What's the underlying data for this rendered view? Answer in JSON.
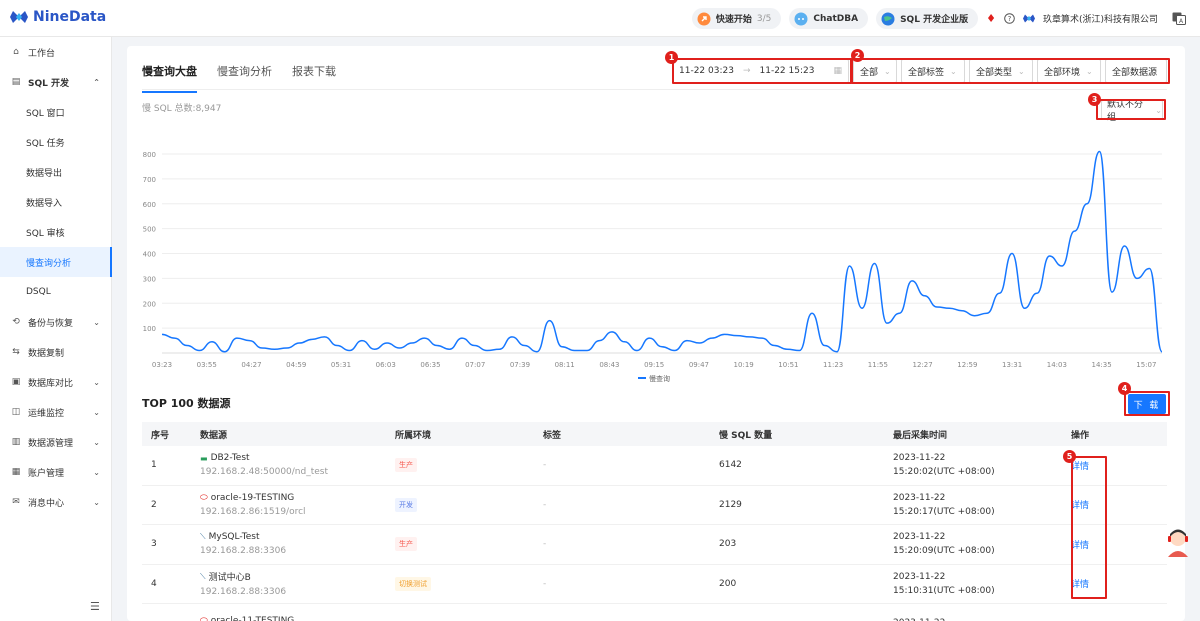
{
  "brand": {
    "name": "NineData",
    "color": "#2a56c6"
  },
  "topbar": {
    "quick_start": "快速开始",
    "quick_start_progress": "3/5",
    "chatdba": "ChatDBA",
    "edition": "SQL 开发企业版",
    "company": "玖章算术(浙江)科技有限公司"
  },
  "sidebar": {
    "items": [
      {
        "label": "工作台",
        "icon": "home-icon"
      },
      {
        "label": "SQL 开发",
        "icon": "sql-dev-icon"
      },
      {
        "label": "SQL 窗口"
      },
      {
        "label": "SQL 任务"
      },
      {
        "label": "数据导出"
      },
      {
        "label": "数据导入"
      },
      {
        "label": "SQL 审核"
      },
      {
        "label": "慢查询分析"
      },
      {
        "label": "DSQL"
      },
      {
        "label": "备份与恢复",
        "icon": "backup-icon"
      },
      {
        "label": "数据复制",
        "icon": "replication-icon"
      },
      {
        "label": "数据库对比",
        "icon": "compare-icon"
      },
      {
        "label": "运维监控",
        "icon": "monitor-icon"
      },
      {
        "label": "数据源管理",
        "icon": "datasource-icon"
      },
      {
        "label": "账户管理",
        "icon": "account-icon"
      },
      {
        "label": "消息中心",
        "icon": "message-icon"
      }
    ]
  },
  "tabs": [
    "慢查询大盘",
    "慢查询分析",
    "报表下载"
  ],
  "filters": {
    "date_start": "11-22 03:23",
    "date_end": "11-22 15:23",
    "selects": [
      "全部",
      "全部标签",
      "全部类型",
      "全部环境",
      "全部数据源"
    ],
    "group": "默认不分组"
  },
  "summary": "慢 SQL 总数:8,947",
  "annotations": [
    "1",
    "2",
    "3",
    "4",
    "5"
  ],
  "chart_data": {
    "type": "line",
    "series": [
      {
        "name": "慢查询",
        "color": "#1677ff",
        "values": [
          75,
          60,
          30,
          10,
          45,
          5,
          60,
          50,
          20,
          15,
          20,
          40,
          55,
          65,
          30,
          10,
          50,
          15,
          40,
          20,
          40,
          60,
          30,
          15,
          60,
          30,
          10,
          15,
          65,
          30,
          5,
          130,
          25,
          10,
          10,
          50,
          85,
          45,
          10,
          60,
          25,
          10,
          50,
          40,
          60,
          75,
          70,
          65,
          60,
          30,
          15,
          10,
          160,
          30,
          5,
          350,
          180,
          360,
          120,
          160,
          290,
          230,
          185,
          180,
          170,
          150,
          160,
          240,
          400,
          180,
          240,
          390,
          350,
          490,
          600,
          810,
          245,
          430,
          300,
          340,
          5
        ]
      }
    ],
    "x_labels": [
      "03:23",
      "03:55",
      "04:27",
      "04:59",
      "05:31",
      "06:03",
      "06:35",
      "07:07",
      "07:39",
      "08:11",
      "08:43",
      "09:15",
      "09:47",
      "10:19",
      "10:51",
      "11:23",
      "11:55",
      "12:27",
      "12:59",
      "13:31",
      "14:03",
      "14:35",
      "15:07"
    ],
    "y_ticks": [
      100,
      200,
      300,
      400,
      500,
      600,
      700,
      800
    ],
    "ylim": [
      0,
      800
    ],
    "legend": "bottom-center",
    "grid": true
  },
  "table": {
    "title": "TOP 100 数据源",
    "download": "下 载",
    "headers": [
      "序号",
      "数据源",
      "所属环境",
      "标签",
      "慢 SQL 数量",
      "最后采集时间",
      "操作"
    ],
    "rows": [
      {
        "no": "1",
        "name": "DB2-Test",
        "host": "192.168.2.48:50000/nd_test",
        "env": "生产",
        "env_type": "prod",
        "tag": "-",
        "count": "6142",
        "date": "2023-11-22",
        "time": "15:20:02(UTC +08:00)",
        "action": "详情",
        "db_icon": "db2-icon"
      },
      {
        "no": "2",
        "name": "oracle-19-TESTING",
        "host": "192.168.2.86:1519/orcl",
        "env": "开发",
        "env_type": "dev",
        "tag": "-",
        "count": "2129",
        "date": "2023-11-22",
        "time": "15:20:17(UTC +08:00)",
        "action": "详情",
        "db_icon": "oracle-icon"
      },
      {
        "no": "3",
        "name": "MySQL-Test",
        "host": "192.168.2.88:3306",
        "env": "生产",
        "env_type": "prod",
        "tag": "-",
        "count": "203",
        "date": "2023-11-22",
        "time": "15:20:09(UTC +08:00)",
        "action": "详情",
        "db_icon": "mysql-icon"
      },
      {
        "no": "4",
        "name": "测试中心B",
        "host": "192.168.2.88:3306",
        "env": "切换测试",
        "env_type": "switch",
        "tag": "-",
        "count": "200",
        "date": "2023-11-22",
        "time": "15:10:31(UTC +08:00)",
        "action": "详情",
        "db_icon": "mysql-icon"
      },
      {
        "no": "",
        "name": "oracle-11-TESTING",
        "host": "",
        "env": "",
        "env_type": "dev",
        "tag": "",
        "count": "",
        "date": "2023-11-22",
        "time": "",
        "action": "",
        "db_icon": "oracle-icon"
      }
    ]
  }
}
